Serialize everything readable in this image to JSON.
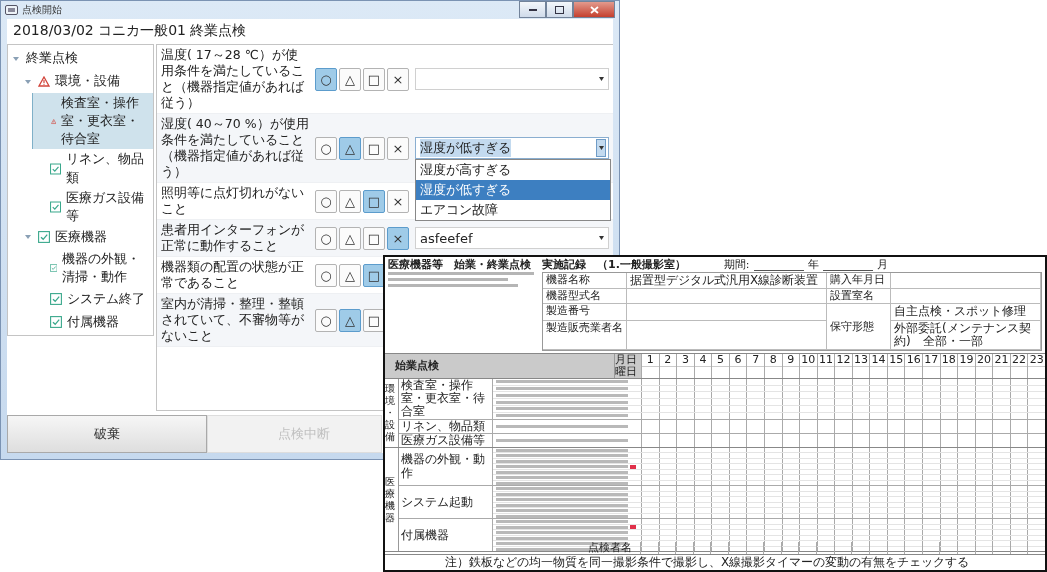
{
  "window": {
    "title": "点検開始"
  },
  "header": "2018/03/02 コニカ一般01 終業点検",
  "tree": [
    {
      "label": "終業点検",
      "expanded": true,
      "selected": false,
      "children": [
        {
          "label": "環境・設備",
          "kind": "warning",
          "expanded": true,
          "selected": false,
          "children": [
            {
              "label": "検査室・操作室・更衣室・待合室",
              "kind": "warning",
              "selected": true
            },
            {
              "label": "リネン、物品類",
              "kind": "done",
              "selected": false
            },
            {
              "label": "医療ガス設備等",
              "kind": "done",
              "selected": false
            }
          ]
        },
        {
          "label": "医療機器",
          "kind": "done",
          "expanded": true,
          "selected": false,
          "children": [
            {
              "label": "機器の外観・清掃・動作",
              "kind": "done",
              "selected": false
            },
            {
              "label": "システム終了",
              "kind": "done",
              "selected": false
            },
            {
              "label": "付属機器",
              "kind": "done",
              "selected": false
            }
          ]
        }
      ]
    }
  ],
  "checklist": [
    {
      "text": "温度( 17～28 ℃）が使用条件を満たしていること（機器指定値があれば従う）",
      "choices": [
        {
          "label": "○",
          "selected": true
        },
        {
          "label": "△",
          "selected": false
        },
        {
          "label": "□",
          "selected": false
        },
        {
          "label": "×",
          "selected": false
        }
      ],
      "dropdown": {
        "open": false
      }
    },
    {
      "text": "湿度( 40～70 %）が使用条件を満たしていること（機器指定値があれば従う）",
      "choices": [
        {
          "label": "○",
          "selected": false
        },
        {
          "label": "△",
          "selected": true
        },
        {
          "label": "□",
          "selected": false
        },
        {
          "label": "×",
          "selected": false
        }
      ],
      "dropdown": {
        "value": "湿度が低すぎる",
        "open": true,
        "options": [
          {
            "label": "湿度が高すぎる",
            "selected": false
          },
          {
            "label": "湿度が低すぎる",
            "selected": true
          },
          {
            "label": "エアコン故障",
            "selected": false
          }
        ]
      }
    },
    {
      "text": "照明等に点灯切れがないこと",
      "choices": [
        {
          "label": "○",
          "selected": false
        },
        {
          "label": "△",
          "selected": false
        },
        {
          "label": "□",
          "selected": true
        },
        {
          "label": "×",
          "selected": false
        }
      ]
    },
    {
      "text": "患者用インターフォンが正常に動作すること",
      "choices": [
        {
          "label": "○",
          "selected": false
        },
        {
          "label": "△",
          "selected": false
        },
        {
          "label": "□",
          "selected": false
        },
        {
          "label": "×",
          "selected": true
        }
      ],
      "dropdown": {
        "value": "asfeefef",
        "open": false
      }
    },
    {
      "text": "機器類の配置の状態が正常であること",
      "choices": [
        {
          "label": "○",
          "selected": false
        },
        {
          "label": "△",
          "selected": false
        },
        {
          "label": "□",
          "selected": true
        }
      ]
    },
    {
      "text": "室内が清掃・整理・整頓されていて、不審物等がないこと",
      "choices": [
        {
          "label": "○",
          "selected": false
        },
        {
          "label": "△",
          "selected": true
        },
        {
          "label": "□",
          "selected": false
        }
      ]
    }
  ],
  "buttons": [
    {
      "label": "破棄",
      "disabled": false
    },
    {
      "label": "点検中断",
      "disabled": true
    }
  ],
  "document": {
    "title": "医療機器等　始業・終業点検　実施記録　（1.一般撮影室）",
    "period_label": "期間:",
    "year_label": "年",
    "month_label": "月",
    "info": [
      {
        "label": "機器名称",
        "value": "据置型デジタル式汎用X線診断装置",
        "label2": "購入年月日"
      },
      {
        "label": "機器型式名",
        "label2": "設置室名"
      },
      {
        "label": "製造番号",
        "label2": "保守形態",
        "option": "自主点検・スポット修理"
      },
      {
        "label": "製造販売業者名",
        "option": "外部委託(メンテナンス契約)　全部・一部"
      }
    ],
    "section_heading": "始業点検",
    "date_label": "月日",
    "weekday_label": "曜日",
    "days": [
      "1",
      "2",
      "3",
      "4",
      "5",
      "6",
      "7",
      "8",
      "9",
      "10",
      "11",
      "12",
      "13",
      "14",
      "15",
      "16",
      "17",
      "18",
      "19",
      "20",
      "21",
      "22",
      "23"
    ],
    "categories": [
      {
        "label": "環境・設備",
        "groups": [
          {
            "label": "検査室・操作室・更衣室・待合室",
            "items": [
              {
                "flagged": false
              },
              {
                "flagged": false
              },
              {
                "flagged": false
              },
              {
                "flagged": false
              },
              {
                "flagged": false
              },
              {
                "flagged": false
              }
            ]
          },
          {
            "label": "リネン、物品類",
            "items": [
              {
                "flagged": false
              }
            ]
          },
          {
            "label": "医療ガス設備等",
            "items": [
              {
                "flagged": false
              }
            ]
          }
        ]
      },
      {
        "label": "医療機器",
        "groups": [
          {
            "label": "機器の外観・動作",
            "items": [
              {
                "flagged": false
              },
              {
                "flagged": false
              },
              {
                "flagged": false
              },
              {
                "flagged": true
              },
              {
                "flagged": false
              },
              {
                "flagged": false
              },
              {
                "flagged": false
              }
            ]
          },
          {
            "label": "システム起動",
            "items": [
              {
                "flagged": false
              },
              {
                "flagged": false
              },
              {
                "flagged": false
              },
              {
                "flagged": false
              },
              {
                "flagged": false
              },
              {
                "flagged": false
              }
            ]
          },
          {
            "label": "付属機器",
            "items": [
              {
                "flagged": false
              },
              {
                "flagged": true
              },
              {
                "flagged": false
              },
              {
                "flagged": false
              },
              {
                "flagged": false
              },
              {
                "flagged": false
              }
            ]
          }
        ]
      }
    ],
    "inspector_label": "点検者名",
    "footnote": "注）鉄板などの均一物質を同一撮影条件で撮影し、X線撮影タイマーの変動の有無をチェックする"
  }
}
